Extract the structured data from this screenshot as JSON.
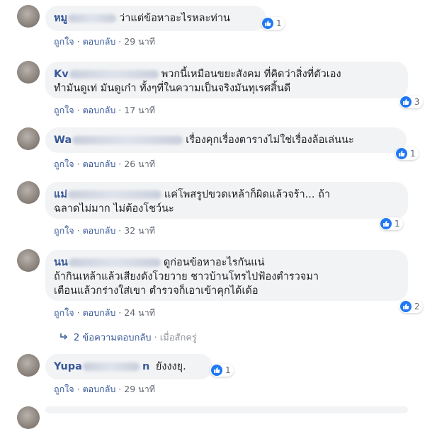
{
  "comments": [
    {
      "author_visible": "หมู",
      "text": "ว่าแต่ข้อหาอะไรหละท่าน",
      "reactions": "1",
      "like_label": "ถูกใจ",
      "reply_label": "ตอบกลับ",
      "time": "29 นาที"
    },
    {
      "author_visible": "Kv",
      "text_line1": "พวกนี้เหมือนขยะสังคม ที่คิดว่าสิ่งที่ตัวเอง",
      "text_line2": "ทำมันดูเท่ มันดูเก๋า ทั้งๆที่ในความเป็นจริงมันทุเรศสิ้นดี",
      "reactions": "3",
      "like_label": "ถูกใจ",
      "reply_label": "ตอบกลับ",
      "time": "17 นาที"
    },
    {
      "author_visible": "Wa",
      "text": "เรื่องคุกเรื่องตารางไม่ใช่เรื่องล้อเล่นนะ",
      "reactions": "1",
      "like_label": "ถูกใจ",
      "reply_label": "ตอบกลับ",
      "time": "26 นาที"
    },
    {
      "author_visible": "แม่",
      "text_line1": "แค่โพสรูปขวดเหล้าก็ผิดแล้วจร้า... ถ้า",
      "text_line2": "ฉลาดไม่มาก ไม่ต้องโชว์นะ",
      "reactions": "1",
      "like_label": "ถูกใจ",
      "reply_label": "ตอบกลับ",
      "time": "32 นาที"
    },
    {
      "author_visible": "นน",
      "text_line1": "ดูก่อนข้อหาอะไรกันแน่",
      "text_line2": "ถ้ากินเหล้าแล้วเสียงดังโวยวาย ชาวบ้านโทรไปฟ้องตำรวจมา",
      "text_line3": "เตือนแล้วกร่างใส่เขา ตำรวจก็เอาเข้าคุกได้เด้อ",
      "reactions": "2",
      "like_label": "ถูกใจ",
      "reply_label": "ตอบกลับ",
      "time": "24 นาที"
    },
    {
      "author_visible": "Yupa",
      "author_visible2": "n",
      "text": "ยังงงยุ.",
      "reactions": "1",
      "like_label": "ถูกใจ",
      "reply_label": "ตอบกลับ",
      "time": "29 นาที"
    }
  ],
  "replies_link": {
    "label": "2 ข้อความตอบกลับ",
    "time": "เมื่อสักครู่"
  },
  "colors": {
    "author": "#385898",
    "bubble": "#f2f3f5",
    "like": "#2078f4",
    "meta": "#606770"
  },
  "icons": [
    "like-icon",
    "reply-arrow-icon"
  ]
}
